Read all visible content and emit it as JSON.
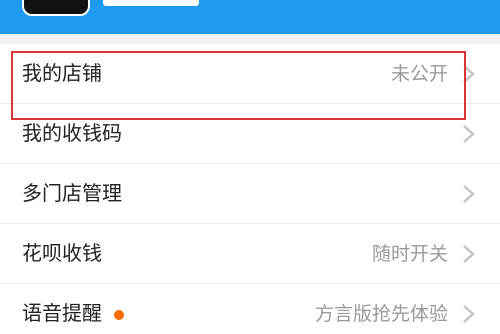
{
  "colors": {
    "header_bg": "#1e9bf0",
    "highlight_border": "#d7353a",
    "dot": "#ff6a00"
  },
  "menu": {
    "items": [
      {
        "label": "我的店铺",
        "value": "未公开"
      },
      {
        "label": "我的收钱码",
        "value": ""
      },
      {
        "label": "多门店管理",
        "value": ""
      },
      {
        "label": "花呗收钱",
        "value": "随时开关"
      },
      {
        "label": "语音提醒",
        "value": "方言版抢先体验"
      }
    ]
  }
}
